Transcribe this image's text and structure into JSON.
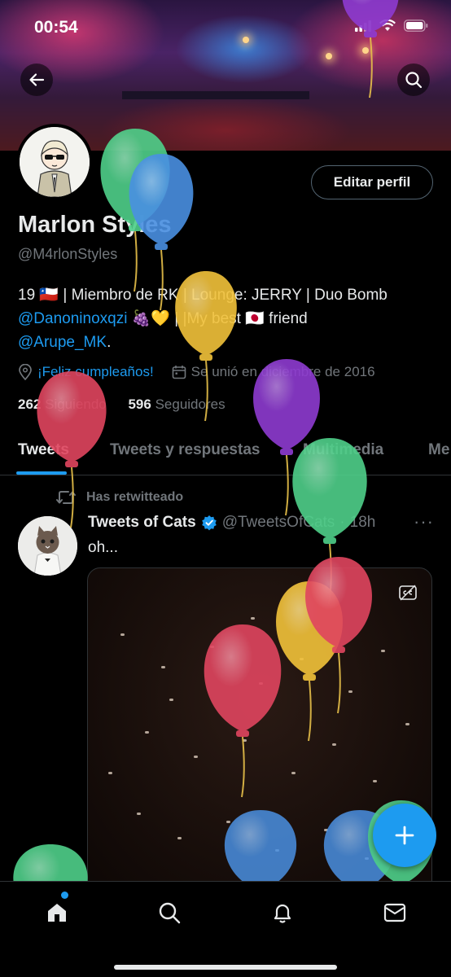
{
  "status_bar": {
    "time": "00:54"
  },
  "profile": {
    "name": "Marlon Styles",
    "handle": "@M4rlonStyles",
    "edit_label": "Editar perfil",
    "bio": {
      "line1": "19 🇨🇱 | Miembro de RK | Lounge: JERRY | Duo Bomb",
      "mention1": "@Danoninoxqzi",
      "line2_rest": " 🍇💛 | |My best 🇯🇵 friend",
      "mention2": "@Arupe_MK",
      "end": "."
    },
    "location": "¡Feliz cumpleaños!",
    "joined": "Se unió en diciembre de 2016",
    "following_count": "262",
    "following_label": "Siguiendo",
    "followers_count": "596",
    "followers_label": "Seguidores"
  },
  "tabs": [
    "Tweets",
    "Tweets y respuestas",
    "Multimedia",
    "Me"
  ],
  "tweet": {
    "retweet_label": "Has retwitteado",
    "author": "Tweets of Cats",
    "handle": "@TweetsOfCats",
    "time": "18h",
    "more": "···",
    "text": "oh..."
  },
  "icons": {
    "back": "arrow-left-icon",
    "search": "search-icon",
    "fab": "compose-plus-icon",
    "nav": [
      "home-icon",
      "search-icon",
      "bell-icon",
      "mail-icon"
    ]
  },
  "colors": {
    "accent": "#1d9bf0",
    "text": "#e7e9ea",
    "muted": "#71767b",
    "balloon_green": "#4fd08a",
    "balloon_blue": "#4a90e2",
    "balloon_yellow": "#f2c23a",
    "balloon_red": "#e0455f",
    "balloon_purple": "#8e3bd1"
  }
}
